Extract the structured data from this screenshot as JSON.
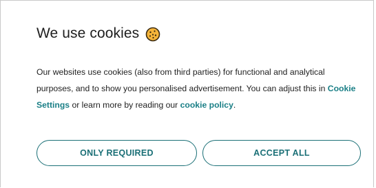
{
  "banner": {
    "title": "We use cookies",
    "icon": "cookie-icon",
    "text_before_settings": "Our websites use cookies (also from third parties) for functional and analytical purposes, and to show you personalised advertisement. You can adjust this in ",
    "settings_link": "Cookie Settings",
    "text_between_links": " or learn more by reading our ",
    "policy_link": "cookie policy",
    "text_end": "."
  },
  "buttons": {
    "only_required": "ONLY REQUIRED",
    "accept_all": "ACCEPT ALL"
  },
  "colors": {
    "accent": "#1a7f86",
    "button_border": "#1a6f76",
    "cookie_fill": "#f6b53a",
    "cookie_outline": "#3a2a10"
  }
}
